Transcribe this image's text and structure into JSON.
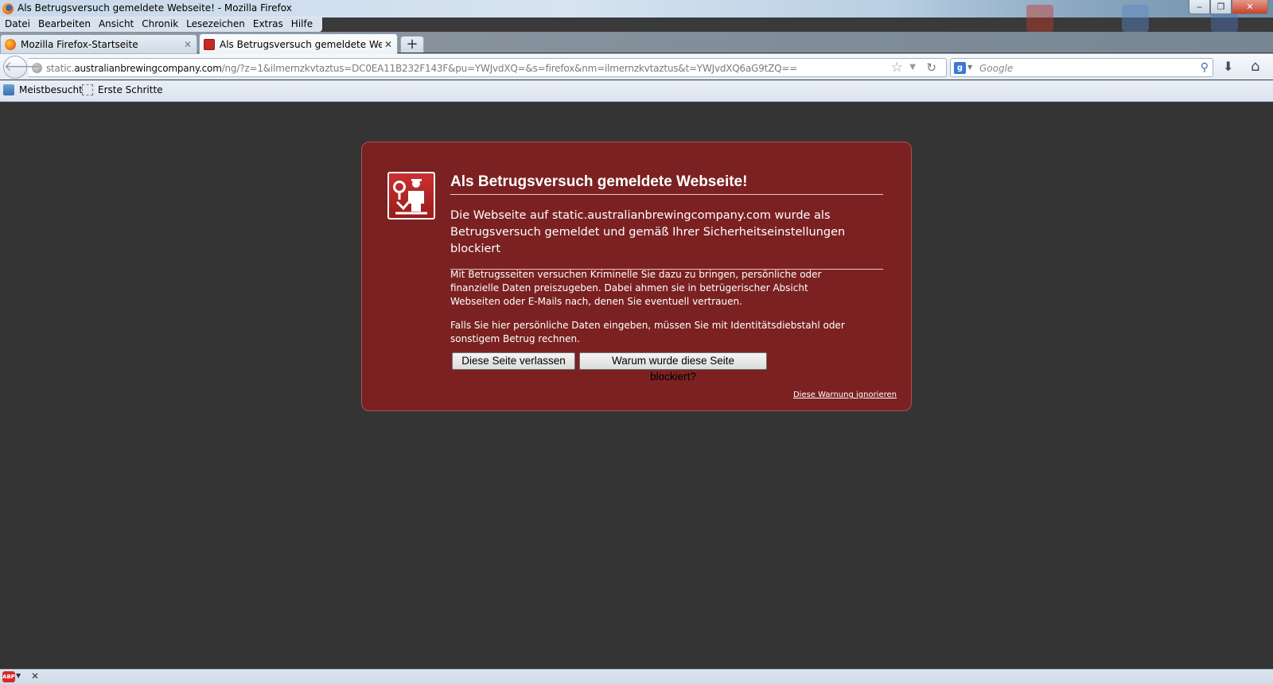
{
  "window": {
    "title": "Als Betrugsversuch gemeldete Webseite! - Mozilla Firefox",
    "controls": {
      "minimize": "‒",
      "maximize": "❐",
      "close": "✕"
    }
  },
  "menu": [
    "Datei",
    "Bearbeiten",
    "Ansicht",
    "Chronik",
    "Lesezeichen",
    "Extras",
    "Hilfe"
  ],
  "tabs": [
    {
      "label": "Mozilla Firefox-Startseite",
      "icon": "firefox-icon",
      "active": false
    },
    {
      "label": "Als Betrugsversuch gemeldete Webse...",
      "icon": "blocked-site-icon",
      "active": true
    }
  ],
  "new_tab_label": "+",
  "nav": {
    "url_prefix": "static.",
    "url_domain": "australianbrewingcompany.com",
    "url_path": "/ng/?z=1&ilmernzkvtaztus=DC0EA11B232F143F&pu=YWJvdXQ=&s=firefox&nm=ilmernzkvtaztus&t=YWJvdXQ6aG9tZQ==",
    "search_placeholder": "Google",
    "search_engine": "g"
  },
  "bookmarks": [
    {
      "label": "Meistbesucht",
      "icon": "most-visited-icon"
    },
    {
      "label": "Erste Schritte",
      "icon": "bookmark-page-icon"
    }
  ],
  "warning": {
    "title": "Als Betrugsversuch gemeldete Webseite!",
    "short_desc": "Die Webseite auf static.australianbrewingcompany.com wurde als Betrugsversuch gemeldet und gemäß Ihrer Sicherheitseinstellungen blockiert",
    "long_desc_1": "Mit Betrugsseiten versuchen Kriminelle Sie dazu zu bringen, persönliche oder finanzielle Daten preiszugeben. Dabei ahmen sie in betrügerischer Absicht Webseiten oder E-Mails nach, denen Sie eventuell vertrauen.",
    "long_desc_2": "Falls Sie hier persönliche Daten eingeben, müssen Sie mit Identitätsdiebstahl oder sonstigem Betrug rechnen.",
    "leave_button": "Diese Seite verlassen",
    "why_button": "Warum wurde diese Seite blockiert?",
    "ignore_link": "Diese Warnung ignorieren"
  },
  "statusbar": {
    "abp": "ABP",
    "close": "✕"
  },
  "colors": {
    "warning_bg": "#7b2121",
    "page_bg": "#343434"
  }
}
